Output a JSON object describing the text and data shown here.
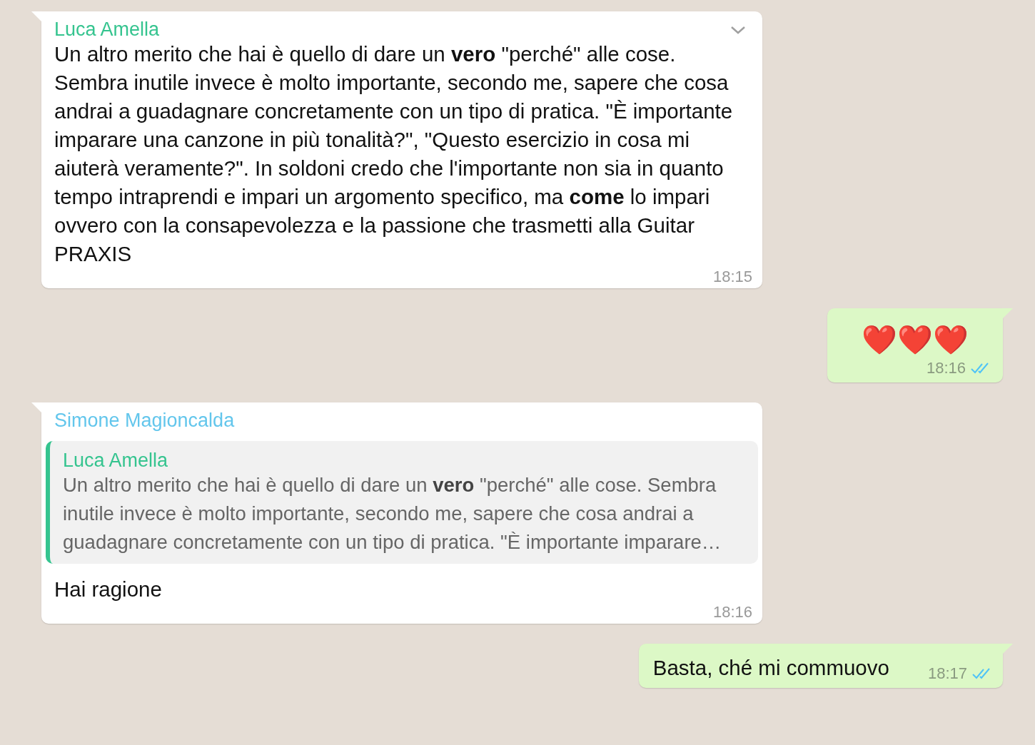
{
  "messages": [
    {
      "kind": "incoming",
      "sender": "Luca Amella",
      "color": "#35c48f",
      "menu": true,
      "text": "Un altro merito che hai è quello di dare un **vero** \"perché\" alle cose. Sembra inutile invece è molto importante, secondo me, sapere che cosa andrai a guadagnare concretamente con un tipo di pratica. \"È importante imparare una canzone in più tonalità?\", \"Questo esercizio in cosa mi aiuterà veramente?\". In soldoni credo che l'importante non sia in quanto tempo intraprendi e impari un argomento specifico, ma **come** lo impari ovvero con la consapevolezza e la passione che trasmetti alla Guitar PRAXIS",
      "time": "18:15"
    },
    {
      "kind": "emoji",
      "text": "❤️❤️❤️",
      "time": "18:16",
      "read": true
    },
    {
      "kind": "incoming",
      "sender": "Simone Magioncalda",
      "color": "#63c6ec",
      "menu": false,
      "quote": {
        "sender": "Luca Amella",
        "color": "#35c48f",
        "text": "Un altro merito che hai è quello di dare un **vero** \"perché\" alle cose. Sembra inutile invece è molto importante, secondo me, sapere che cosa andrai a guadagnare concretamente con un tipo di pratica. \"È importante imparare…"
      },
      "text": "Hai ragione",
      "time": "18:16"
    },
    {
      "kind": "outgoing",
      "text": "Basta, ché mi commuovo",
      "time": "18:17",
      "read": true
    }
  ]
}
